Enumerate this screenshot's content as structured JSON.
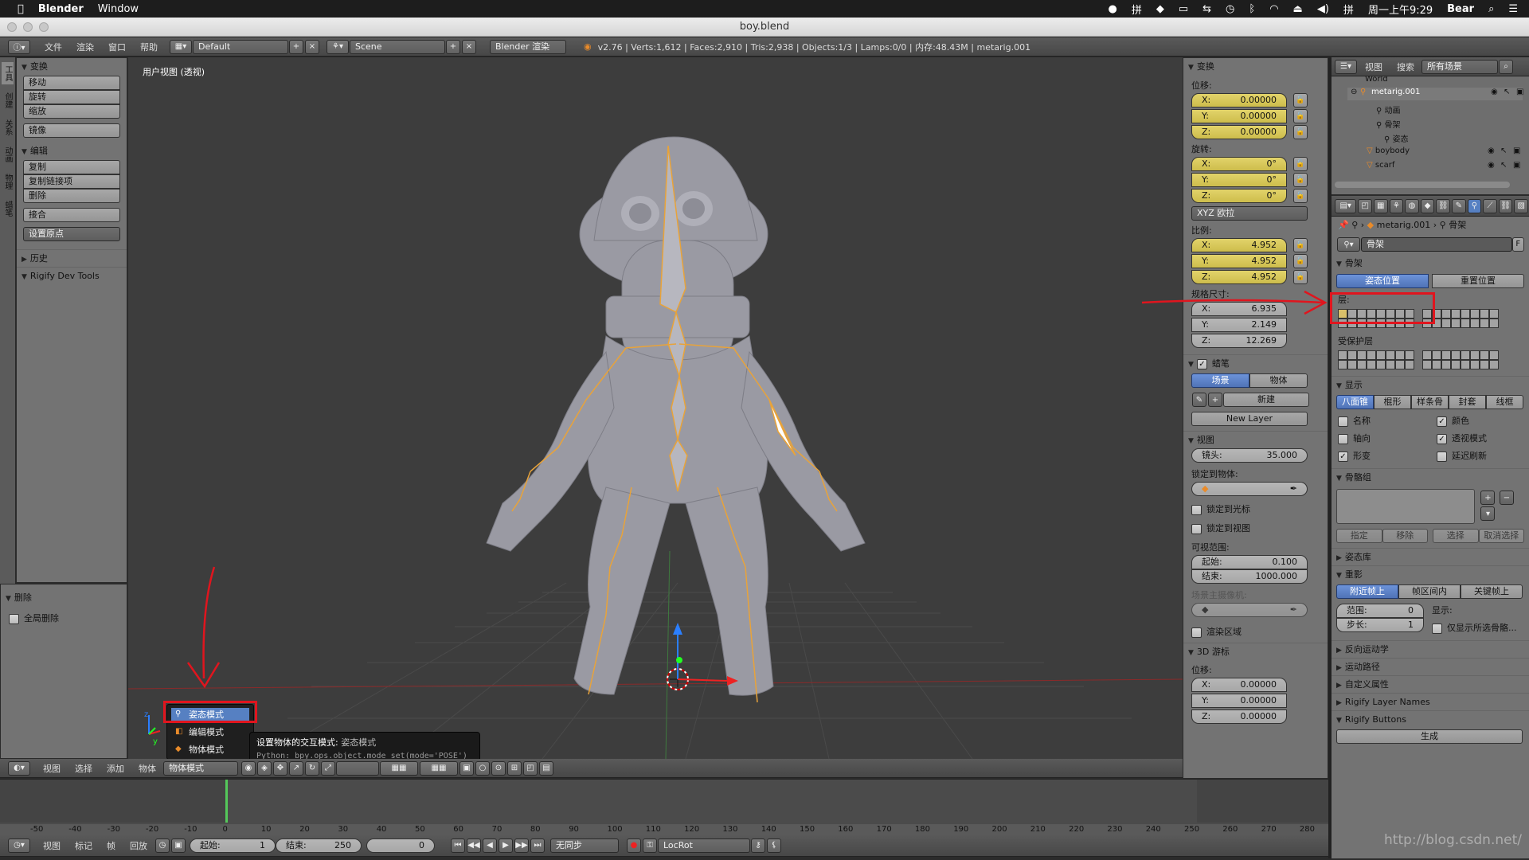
{
  "macbar": {
    "app": "Blender",
    "menu_window": "Window",
    "datetime": "周一上午9:29",
    "user": "Bear",
    "input_method": "拼"
  },
  "window": {
    "title": "boy.blend"
  },
  "info_header": {
    "menus": [
      "文件",
      "渲染",
      "窗口",
      "帮助"
    ],
    "layout": "Default",
    "scene": "Scene",
    "engine": "Blender 渲染",
    "stats": "v2.76 | Verts:1,612 | Faces:2,910 | Tris:2,938 | Objects:1/3 | Lamps:0/0 | 内存:48.43M | metarig.001"
  },
  "toolshelf": {
    "transform_title": "变换",
    "transform_buttons": [
      "移动",
      "旋转",
      "缩放"
    ],
    "mirror": "镜像",
    "edit_title": "编辑",
    "edit_buttons": [
      "复制",
      "复制链接项",
      "删除"
    ],
    "join": "接合",
    "set_origin": "设置原点",
    "history_title": "历史",
    "rigify_title": "Rigify Dev Tools",
    "vtabs": [
      "工具",
      "创建",
      "关系",
      "动画",
      "物理",
      "蜡笔"
    ],
    "op_title": "删除",
    "op_global": "全局删除"
  },
  "viewport": {
    "label": "用户视图 (透视)"
  },
  "mode_menu": {
    "items": [
      "姿态模式",
      "编辑模式",
      "物体模式"
    ],
    "tooltip_title": "设置物体的交互模式: ",
    "tooltip_value": "姿态模式",
    "tooltip_python": "Python: bpy.ops.object.mode_set(mode='POSE')"
  },
  "view3d_header": {
    "menus": [
      "视图",
      "选择",
      "添加",
      "物体"
    ],
    "mode": "物体模式"
  },
  "npanel": {
    "transform_title": "变换",
    "location": "位移:",
    "loc": [
      "0.00000",
      "0.00000",
      "0.00000"
    ],
    "rotation": "旋转:",
    "rot": [
      "0°",
      "0°",
      "0°"
    ],
    "rotmode": "XYZ 欧拉",
    "scale": "比例:",
    "scl": [
      "4.952",
      "4.952",
      "4.952"
    ],
    "dims": "规格尺寸:",
    "dim": [
      "6.935",
      "2.149",
      "12.269"
    ],
    "axes": [
      "X:",
      "Y:",
      "Z:"
    ],
    "gp_title": "蜡笔",
    "gp_scene": "场景",
    "gp_object": "物体",
    "gp_new": "新建",
    "gp_newlayer": "New Layer",
    "view_title": "视图",
    "lens_label": "镜头:",
    "lens_value": "35.000",
    "lock_obj": "锁定到物体:",
    "lock_cursor": "锁定到光标",
    "lock_view": "锁定到视图",
    "clip": "可视范围:",
    "clip_start_label": "起始:",
    "clip_start": "0.100",
    "clip_end_label": "结束:",
    "clip_end": "1000.000",
    "local_cam": "场景主摄像机:",
    "render_border": "渲染区域",
    "cursor_title": "3D 游标",
    "cursor_loc": "位移:",
    "cur": [
      "0.00000",
      "0.00000",
      "0.00000"
    ]
  },
  "outliner": {
    "menus": [
      "视图",
      "搜索"
    ],
    "filter": "所有场景",
    "items": [
      "World",
      "metarig.001",
      "动画",
      "骨架",
      "姿态",
      "boybody",
      "scarf"
    ]
  },
  "props": {
    "breadcrumb_obj": "metarig.001",
    "breadcrumb_arm": "骨架",
    "data_name": "骨架",
    "fake": "F",
    "skeleton_title": "骨架",
    "pose_position": "姿态位置",
    "rest_position": "重置位置",
    "layers_label": "层:",
    "protected_label": "受保护层",
    "display_title": "显示",
    "display_types": [
      "八面锥",
      "棍形",
      "样条骨",
      "封套",
      "线框"
    ],
    "opt_name": "名称",
    "opt_axes": "轴向",
    "opt_shape": "形变",
    "opt_colors": "颜色",
    "opt_xray": "透视模式",
    "opt_delay": "延迟刷新",
    "bone_groups_title": "骨骼组",
    "bg_assign": "指定",
    "bg_remove": "移除",
    "bg_select": "选择",
    "bg_deselect": "取消选择",
    "pose_library": "姿态库",
    "ghost_title": "重影",
    "ghost_types": [
      "附近帧上",
      "帧区间内",
      "关键帧上"
    ],
    "range_label": "范围:",
    "range_value": "0",
    "step_label": "步长:",
    "step_value": "1",
    "display_label": "显示:",
    "only_selected": "仅显示所选骨骼...",
    "ik": "反向运动学",
    "motion_paths": "运动路径",
    "custom_props": "自定义属性",
    "rigify_layer": "Rigify Layer Names",
    "rigify_buttons": "Rigify Buttons",
    "generate": "生成"
  },
  "timeline": {
    "ticks": [
      "-50",
      "-40",
      "-30",
      "-20",
      "-10",
      "0",
      "10",
      "20",
      "30",
      "40",
      "50",
      "60",
      "70",
      "80",
      "90",
      "100",
      "110",
      "120",
      "130",
      "140",
      "150",
      "160",
      "170",
      "180",
      "190",
      "200",
      "210",
      "220",
      "230",
      "240",
      "250",
      "260",
      "270",
      "280"
    ],
    "menus": [
      "视图",
      "标记",
      "帧",
      "回放"
    ],
    "start_label": "起始:",
    "start": "1",
    "end_label": "结束:",
    "end": "250",
    "current": "0",
    "sync": "无同步",
    "keying": "LocRot"
  },
  "watermark": "http://blog.csdn.net/",
  "colors": {
    "accent": "#5680c2",
    "annotation": "#e0151e",
    "bone": "#e8a33a"
  }
}
